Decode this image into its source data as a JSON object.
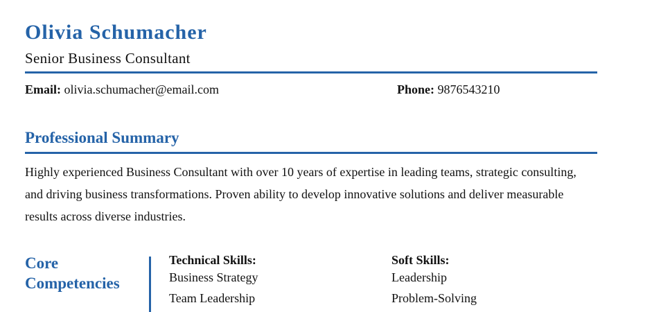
{
  "header": {
    "name": "Olivia Schumacher",
    "job_title": "Senior Business Consultant"
  },
  "contact": {
    "email_label": "Email:",
    "email_value": "olivia.schumacher@email.com",
    "phone_label": "Phone:",
    "phone_value": "9876543210"
  },
  "summary": {
    "title": "Professional Summary",
    "text": "Highly experienced Business Consultant with over 10 years of expertise in leading teams, strategic consulting, and driving business transformations. Proven ability to develop innovative solutions and deliver measurable results across diverse industries."
  },
  "competencies": {
    "title_line1": "Core",
    "title_line2": "Competencies",
    "technical": {
      "heading": "Technical Skills:",
      "items": [
        "Business Strategy",
        "Team Leadership"
      ]
    },
    "soft": {
      "heading": "Soft Skills:",
      "items": [
        "Leadership",
        "Problem-Solving"
      ]
    }
  },
  "colors": {
    "accent": "#2563a8",
    "text": "#111111",
    "background": "#ffffff"
  }
}
